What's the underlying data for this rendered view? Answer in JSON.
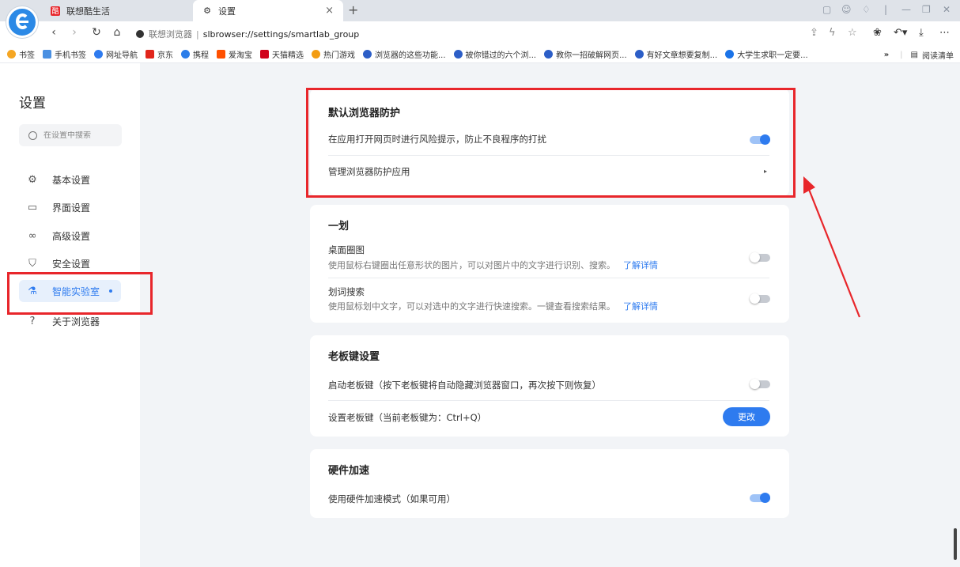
{
  "tabs": [
    {
      "label": "联想酷生活",
      "favicon_color": "#e8262b"
    },
    {
      "label": "设置",
      "close": "×"
    }
  ],
  "new_tab": "+",
  "address": {
    "site_label": "联想浏览器",
    "separator": "|",
    "url": "slbrowser://settings/smartlab_group"
  },
  "bookmarks": [
    {
      "label": "书签",
      "color": "#f5a623"
    },
    {
      "label": "手机书签",
      "color": "#4a90e2"
    },
    {
      "label": "网址导航",
      "color": "#2e7bef"
    },
    {
      "label": "京东",
      "color": "#e1251b"
    },
    {
      "label": "携程",
      "color": "#2b7de9"
    },
    {
      "label": "爱淘宝",
      "color": "#ff5000"
    },
    {
      "label": "天猫精选",
      "color": "#d0021b"
    },
    {
      "label": "热门游戏",
      "color": "#f39c12"
    },
    {
      "label": "浏览器的这些功能...",
      "color": "#2c5ec7"
    },
    {
      "label": "被你错过的六个浏...",
      "color": "#2c5ec7"
    },
    {
      "label": "教你一招破解网页...",
      "color": "#2c5ec7"
    },
    {
      "label": "有好文章想要复制...",
      "color": "#2c5ec7"
    },
    {
      "label": "大学生求职一定要...",
      "color": "#1a73e8"
    }
  ],
  "bookmarks_more": "»",
  "reading_list": "阅读清单",
  "sidebar": {
    "title": "设置",
    "search_placeholder": "在设置中搜索",
    "items": [
      {
        "label": "基本设置",
        "icon": "gear-icon"
      },
      {
        "label": "界面设置",
        "icon": "window-icon"
      },
      {
        "label": "高级设置",
        "icon": "circles-icon"
      },
      {
        "label": "安全设置",
        "icon": "shield-icon"
      },
      {
        "label": "智能实验室",
        "icon": "flask-icon",
        "active": true
      },
      {
        "label": "关于浏览器",
        "icon": "question-icon"
      }
    ]
  },
  "sections": {
    "protection": {
      "title": "默认浏览器防护",
      "risk_label": "在应用打开网页时进行风险提示，防止不良程序的打扰",
      "risk_on": true,
      "manage_label": "管理浏览器防护应用"
    },
    "yihua": {
      "title": "一划",
      "desktop_title": "桌面圈图",
      "desktop_desc": "使用鼠标右键圈出任意形状的图片，可以对图片中的文字进行识别、搜索。",
      "desktop_more": "了解详情",
      "desktop_on": false,
      "word_title": "划词搜索",
      "word_desc": "使用鼠标划中文字，可以对选中的文字进行快速搜索。一键查看搜索结果。",
      "word_more": "了解详情",
      "word_on": false
    },
    "boss": {
      "title": "老板键设置",
      "enable_label": "启动老板键（按下老板键将自动隐藏浏览器窗口，再次按下则恢复）",
      "enable_on": false,
      "set_label": "设置老板键（当前老板键为：Ctrl+Q）",
      "change_button": "更改"
    },
    "hardware": {
      "title": "硬件加速",
      "accel_label": "使用硬件加速模式（如果可用）",
      "accel_on": true
    }
  },
  "colors": {
    "accent": "#2e7bef",
    "annotation": "#e8262b"
  }
}
